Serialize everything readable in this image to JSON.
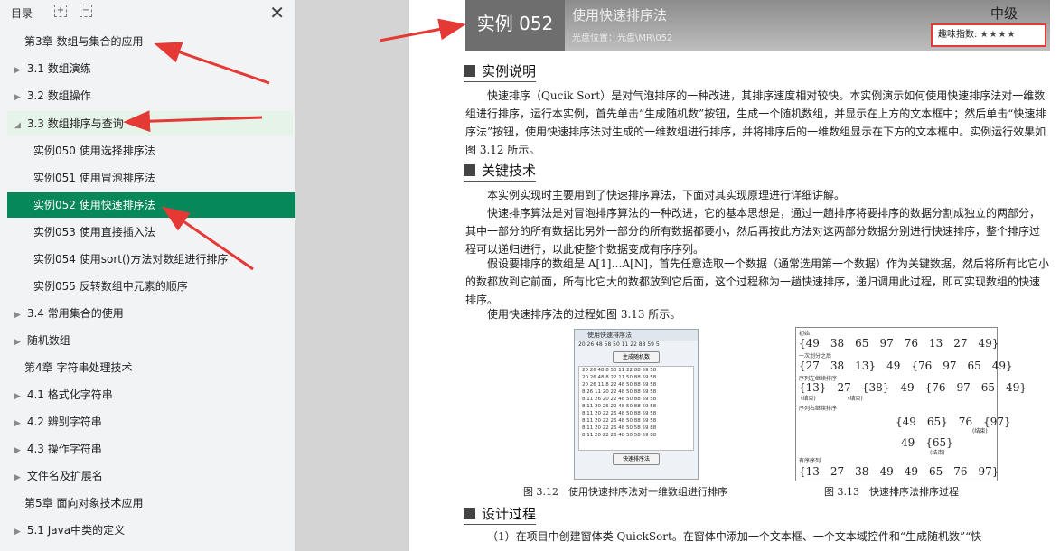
{
  "sidebar": {
    "title": "目录",
    "expand_icon": "expand-icon",
    "collapse_icon": "collapse-icon",
    "close_glyph": "✕",
    "items": [
      {
        "label": "第3章 数组与集合的应用",
        "level": 0,
        "arrow": ""
      },
      {
        "label": "3.1 数组演练",
        "level": 1,
        "arrow": "▶"
      },
      {
        "label": "3.2 数组操作",
        "level": 1,
        "arrow": "▶"
      },
      {
        "label": "3.3 数组排序与查询",
        "level": 1,
        "arrow": "◢",
        "state": "highlight"
      },
      {
        "label": "实例050 使用选择排序法",
        "level": 2,
        "arrow": ""
      },
      {
        "label": "实例051 使用冒泡排序法",
        "level": 2,
        "arrow": ""
      },
      {
        "label": "实例052 使用快速排序法",
        "level": 2,
        "arrow": "",
        "state": "active"
      },
      {
        "label": "实例053 使用直接插入法",
        "level": 2,
        "arrow": ""
      },
      {
        "label": "实例054 使用sort()方法对数组进行排序",
        "level": 2,
        "arrow": ""
      },
      {
        "label": "实例055 反转数组中元素的顺序",
        "level": 2,
        "arrow": ""
      },
      {
        "label": "3.4 常用集合的使用",
        "level": 1,
        "arrow": "▶"
      },
      {
        "label": "随机数组",
        "level": 1,
        "arrow": "▶"
      },
      {
        "label": "第4章 字符串处理技术",
        "level": 0,
        "arrow": ""
      },
      {
        "label": "4.1 格式化字符串",
        "level": 1,
        "arrow": "▶"
      },
      {
        "label": "4.2 辨别字符串",
        "level": 1,
        "arrow": "▶"
      },
      {
        "label": "4.3 操作字符串",
        "level": 1,
        "arrow": "▶"
      },
      {
        "label": "文件名及扩展名",
        "level": 1,
        "arrow": "▶"
      },
      {
        "label": "第5章 面向对象技术应用",
        "level": 0,
        "arrow": ""
      },
      {
        "label": "5.1 Java中类的定义",
        "level": 1,
        "arrow": "▶"
      }
    ]
  },
  "page": {
    "banner": {
      "example_no": "实例 052",
      "title": "使用快速排序法",
      "location": "光盘位置：光盘\\MR\\052",
      "level": "中级",
      "fun_label": "趣味指数:",
      "fun_stars": "★★★★"
    },
    "sections": {
      "desc_title": "实例说明",
      "desc_text": "快速排序（Qucik Sort）是对气泡排序的一种改进，其排序速度相对较快。本实例演示如何使用快速排序法对一维数组进行排序，运行本实例，首先单击“生成随机数”按钮，生成一个随机数组，并显示在上方的文本框中；然后单击“快速排序法”按钮，使用快速排序法对生成的一维数组进行排序，并将排序后的一维数组显示在下方的文本框中。实例运行效果如图 3.12 所示。",
      "key_title": "关键技术",
      "key_p1": "本实例实现时主要用到了快速排序算法，下面对其实现原理进行详细讲解。",
      "key_p2": "快速排序算法是对冒泡排序算法的一种改进，它的基本思想是，通过一趟排序将要排序的数据分割成独立的两部分，其中一部分的所有数据比另外一部分的所有数据都要小，然后再按此方法对这两部分数据分别进行快速排序，整个排序过程可以递归进行，以此使整个数据变成有序序列。",
      "key_p3": "假设要排序的数组是 A[1]…A[N]，首先任意选取一个数据（通常选用第一个数据）作为关键数据，然后将所有比它小的数都放到它前面，所有比它大的数都放到它后面，这个过程称为一趟快速排序，递归调用此过程，即可实现数组的快速排序。",
      "key_p4": "使用快速排序法的过程如图 3.13 所示。",
      "design_title": "设计过程",
      "design_p1": "（1）在项目中创建窗体类 QuickSort。在窗体中添加一个文本框、一个文本域控件和“生成随机数”“快"
    },
    "fig312": {
      "window_title": "使用快速排序法",
      "random_row": "20 26 48 58 50 11 22 88 59 5",
      "gen_button": "生成随机数",
      "area_text": "20 26 48 8 50 11 22 88 59 58\n20 26 48 8 22 11 50 88 59 58\n20 26 11 8 22 48 50 88 59 58\n8 26 11 20 22 48 50 88 59 58\n8 11 26 20 22 48 50 88 59 58\n8 11 20 26 22 48 50 88 59 58\n8 11 20 22 26 48 50 88 59 58\n8 11 20 22 26 48 50 88 59 58\n8 11 20 22 26 48 50 58 59 88\n8 11 20 22 26 48 50 58 59 88",
      "sort_button": "快速排序法",
      "caption": "图 3.12　使用快速排序法对一维数组进行排序"
    },
    "fig313": {
      "labels": [
        "初始",
        "一次划分之后",
        "序列左继续排序",
        "(结束)",
        "(结束)",
        "序列右继续排序",
        "(结束)",
        "(结束)",
        "有序序列"
      ],
      "rows": [
        "{49　38　65　97　76　13　27　49}",
        "{27　38　13}　49　{76　97　65　49}",
        "{13}　27　{38}　49　{76　97　65　49}",
        "{49　65}　76　{97}",
        "49　{65}",
        "{13　27　38　49　49　65　76　97}"
      ],
      "caption": "图 3.13　快速排序法排序过程"
    },
    "annotation_color": "#e53935",
    "active_color": "#07885a"
  }
}
